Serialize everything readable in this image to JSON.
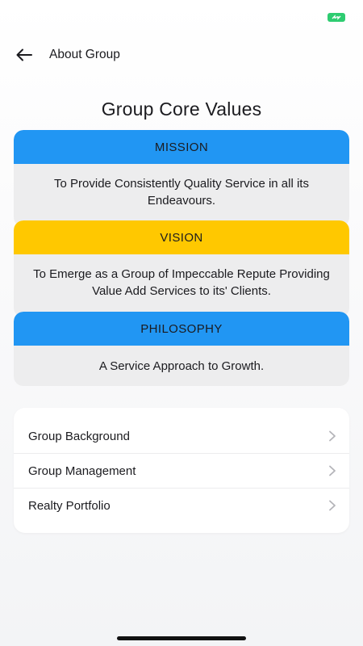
{
  "nav": {
    "title": "About Group"
  },
  "icons": {
    "back": "arrow-left-icon",
    "battery": "battery-charging-icon",
    "chevron": "chevron-right-icon"
  },
  "core_values": {
    "title": "Group Core Values",
    "items": [
      {
        "header": "MISSION",
        "text": "To Provide Consistently Quality Service in all its Endeavours.",
        "color": "#2196f3"
      },
      {
        "header": "VISION",
        "text": "To Emerge as a Group of Impeccable Repute Providing Value Add Services to its' Clients.",
        "color": "#ffc800"
      },
      {
        "header": "PHILOSOPHY",
        "text": "A Service Approach to Growth.",
        "color": "#2196f3"
      }
    ]
  },
  "menu": {
    "items": [
      {
        "label": "Group Background"
      },
      {
        "label": "Group Management"
      },
      {
        "label": "Realty Portfolio"
      }
    ]
  },
  "colors": {
    "card_body": "#ededee",
    "battery": "#2ecc71",
    "chevron": "#b4b4b9"
  }
}
